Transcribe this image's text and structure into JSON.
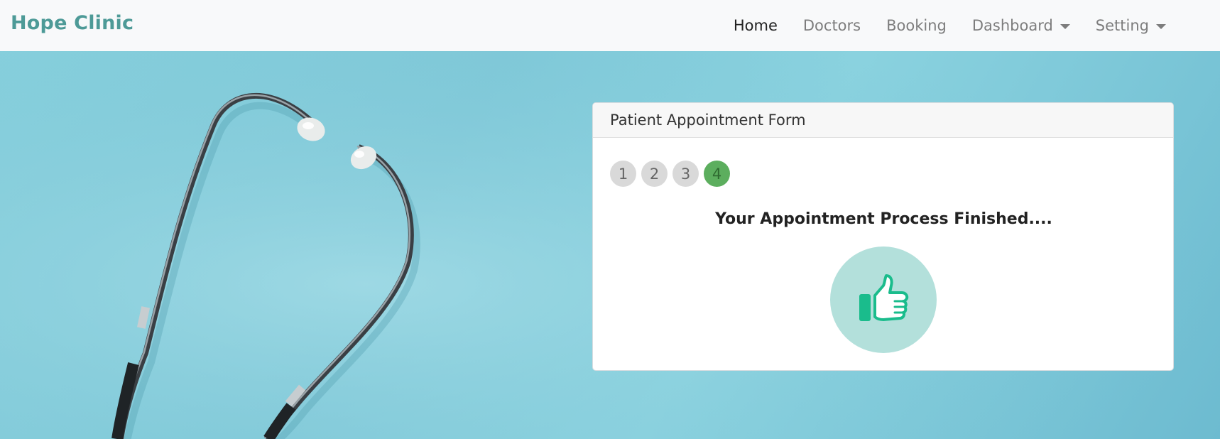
{
  "navbar": {
    "brand": "Hope Clinic",
    "items": [
      {
        "label": "Home",
        "active": true,
        "dropdown": false
      },
      {
        "label": "Doctors",
        "active": false,
        "dropdown": false
      },
      {
        "label": "Booking",
        "active": false,
        "dropdown": false
      },
      {
        "label": "Dashboard",
        "active": false,
        "dropdown": true
      },
      {
        "label": "Setting",
        "active": false,
        "dropdown": true
      }
    ]
  },
  "card": {
    "title": "Patient Appointment Form",
    "steps": [
      "1",
      "2",
      "3",
      "4"
    ],
    "current_step": 4,
    "message": "Your Appointment Process Finished....",
    "icon": "thumbs-up-icon"
  },
  "colors": {
    "brand": "#4d9a97",
    "step_active": "#5cae5e",
    "thumb": "#1abc8c",
    "thumb_circle": "#b3e0db"
  }
}
